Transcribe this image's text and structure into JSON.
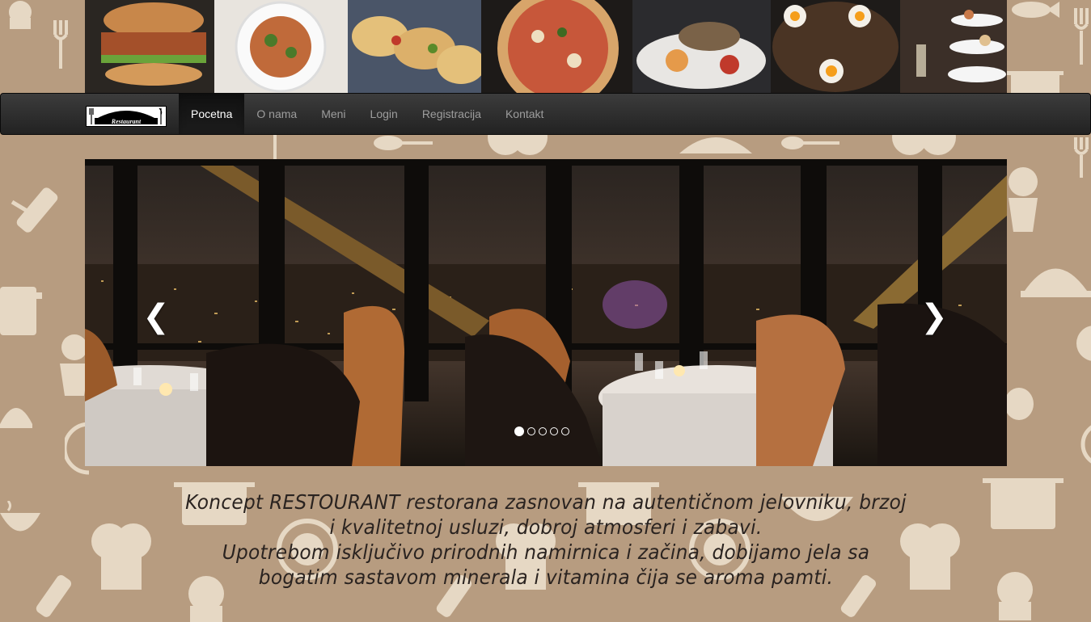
{
  "navbar": {
    "brand_text": "Restaurant",
    "items": [
      {
        "label": "Pocetna",
        "active": true
      },
      {
        "label": "O nama",
        "active": false
      },
      {
        "label": "Meni",
        "active": false
      },
      {
        "label": "Login",
        "active": false
      },
      {
        "label": "Registracija",
        "active": false
      },
      {
        "label": "Kontakt",
        "active": false
      }
    ]
  },
  "header": {
    "food_photos": [
      "burger",
      "spaghetti",
      "tacos",
      "pizza",
      "grilled-fish",
      "eggs-skillet",
      "dessert-tower"
    ]
  },
  "carousel": {
    "slide_count": 5,
    "active_index": 0,
    "prev_icon": "chevron-left-icon",
    "next_icon": "chevron-right-icon"
  },
  "intro": {
    "paragraph_1": "Koncept RESTOURANT restorana zasnovan na autentičnom jelovniku, brzoj i kvalitetnoj usluzi, dobroj atmosferi i zabavi.",
    "paragraph_2": "Upotrebom isključivo prirodnih namirnica i začina, dobijamo jela sa bogatim sastavom minerala i vitamina čija se aroma pamti."
  },
  "colors": {
    "background": "#b79c80",
    "pattern": "#efe3d0",
    "navbar": "#222222",
    "nav_text": "#9d9d9d",
    "nav_active_text": "#ffffff"
  }
}
